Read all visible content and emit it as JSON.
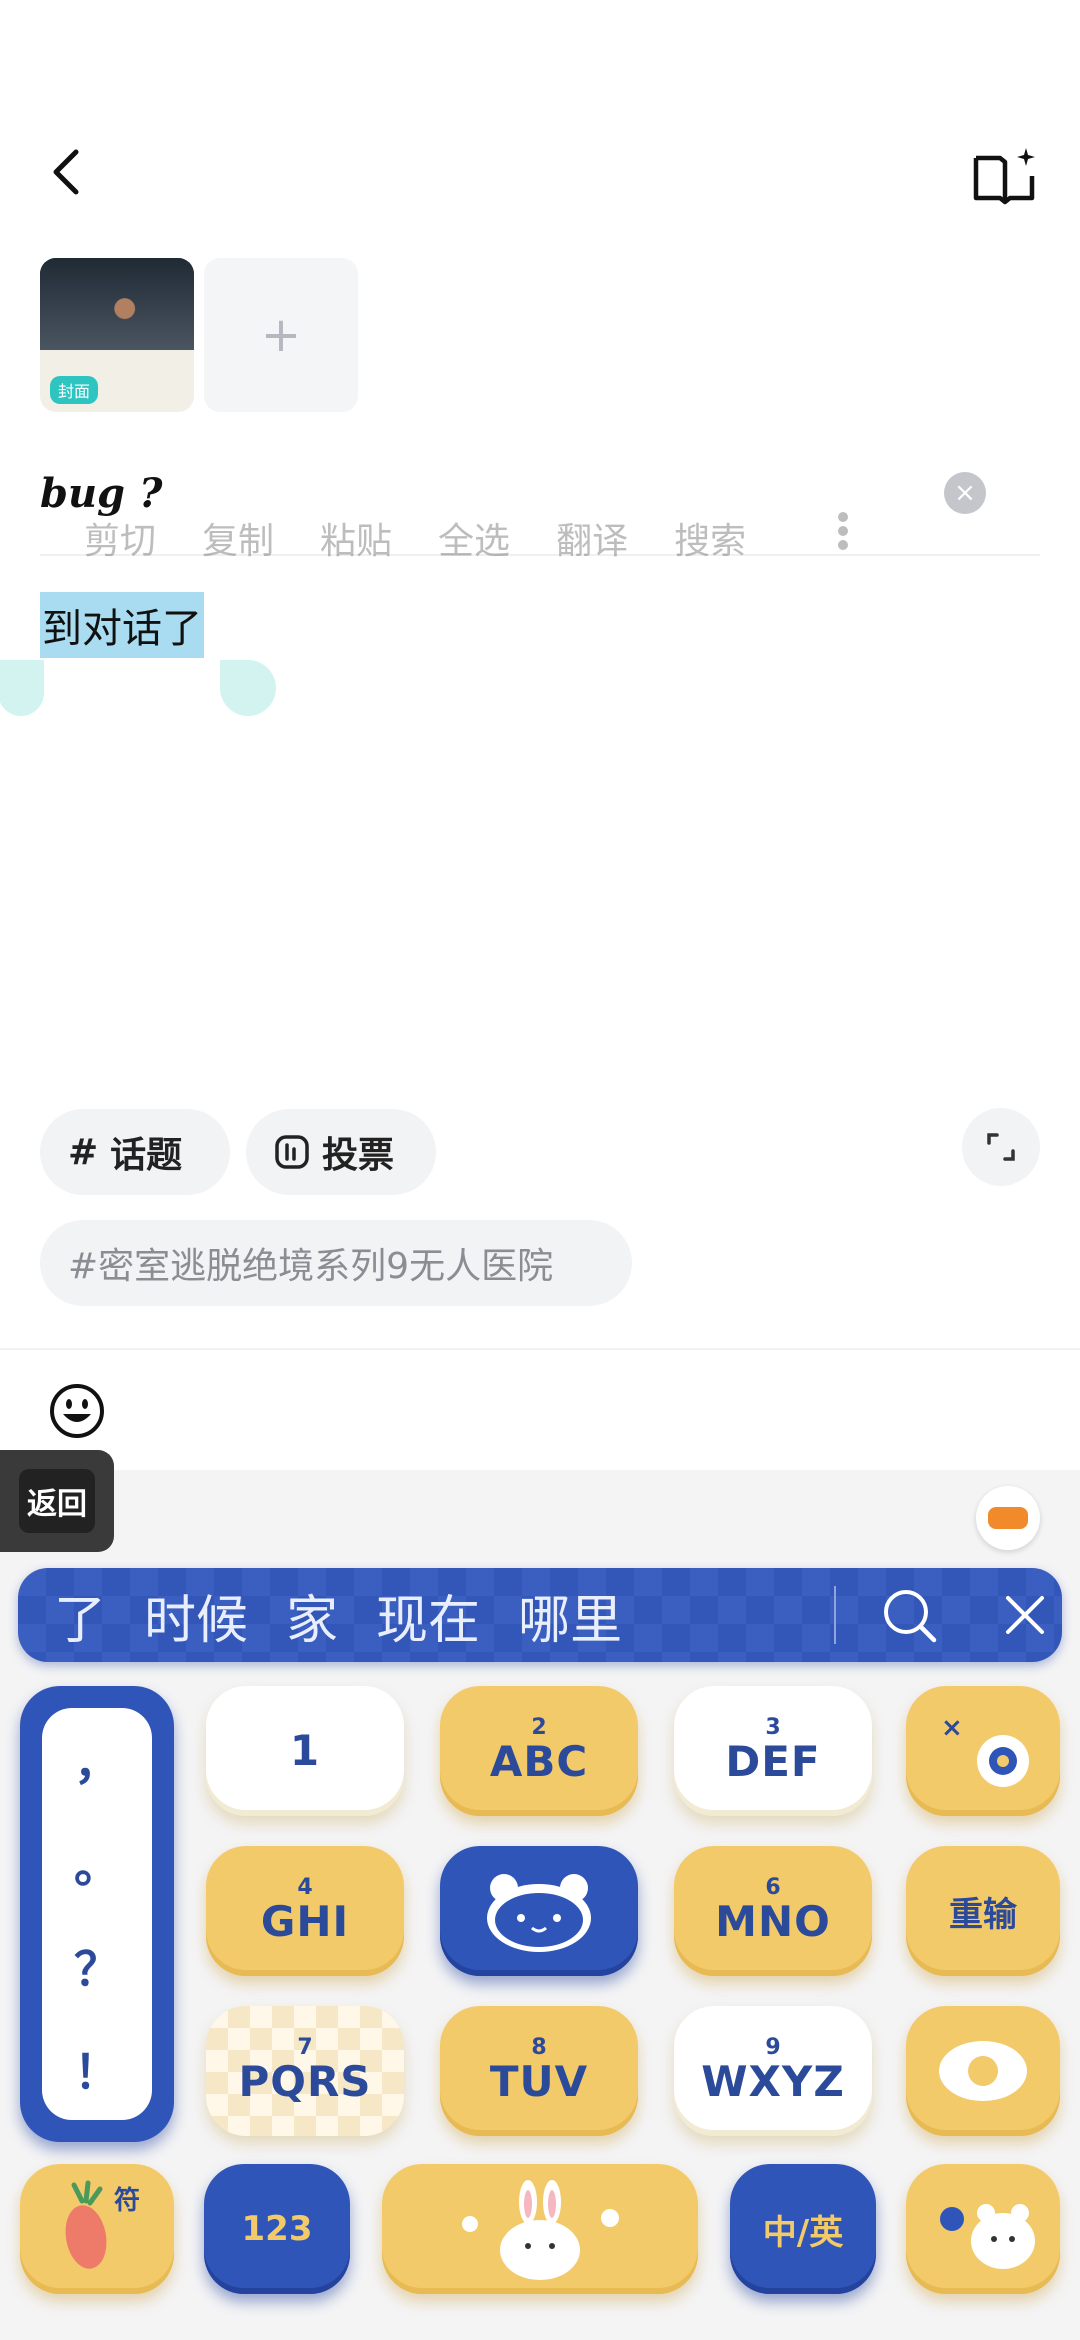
{
  "header": {
    "back_icon": "chevron-left-icon",
    "guide_icon": "book-sparkle-icon"
  },
  "media": {
    "cover_badge": "封面",
    "add_symbol": "+"
  },
  "editor": {
    "title": "bug ?",
    "clear_symbol": "×",
    "body": "到对话了"
  },
  "context_menu": {
    "items": [
      "剪切",
      "复制",
      "粘贴",
      "全选",
      "翻译",
      "搜索"
    ]
  },
  "chips": {
    "topic": "话题",
    "topic_icon": "#",
    "vote": "投票",
    "hashtag": "#密室逃脱绝境系列9无人医院"
  },
  "keyboard": {
    "return_label": "返回",
    "candidates": [
      "了",
      "时候",
      "家",
      "现在",
      "哪里"
    ],
    "punctuation": [
      "，",
      "。",
      "？",
      "！"
    ],
    "keys": {
      "k1": {
        "num": "1"
      },
      "k2": {
        "num": "2",
        "letters": "ABC"
      },
      "k3": {
        "num": "3",
        "letters": "DEF"
      },
      "k4": {
        "num": "4",
        "letters": "GHI"
      },
      "k6": {
        "num": "6",
        "letters": "MNO"
      },
      "k7": {
        "num": "7",
        "letters": "PQRS"
      },
      "k8": {
        "num": "8",
        "letters": "TUV"
      },
      "k9": {
        "num": "9",
        "letters": "WXYZ"
      },
      "retype": "重输",
      "symbols": "符",
      "numbers": "123",
      "lang": "中/英"
    },
    "colors": {
      "yellow": "#f2ca6a",
      "blue": "#2f55b8",
      "text": "#2c4a9a"
    }
  }
}
